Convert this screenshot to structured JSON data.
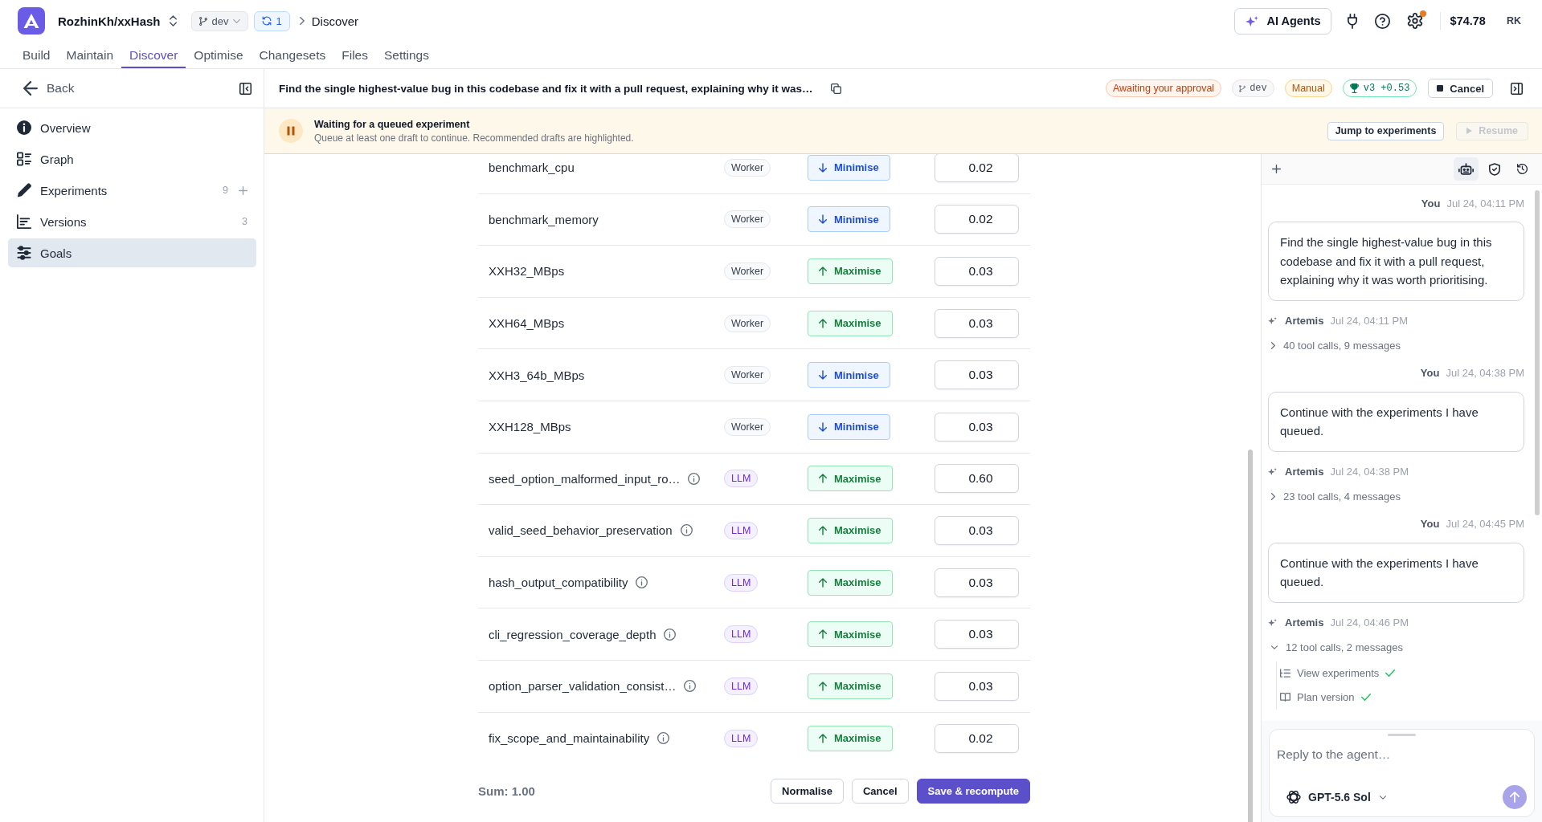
{
  "app_bar": {
    "repository": "RozhinKh/xxHash",
    "branch": "dev",
    "sync_count": "1",
    "breadcrumb": "Discover",
    "ai_agents_button": "AI Agents",
    "settings_notification": true,
    "balance": "$74.78",
    "user_initials": "RK"
  },
  "nav_tabs": [
    {
      "label": "Build",
      "selected": false
    },
    {
      "label": "Maintain",
      "selected": false
    },
    {
      "label": "Discover",
      "selected": true
    },
    {
      "label": "Optimise",
      "selected": false
    },
    {
      "label": "Changesets",
      "selected": false
    },
    {
      "label": "Files",
      "selected": false
    },
    {
      "label": "Settings",
      "selected": false
    }
  ],
  "sidebar": {
    "back_button": "Back",
    "items": [
      {
        "label": "Overview",
        "selected": false,
        "addable": false
      },
      {
        "label": "Graph",
        "selected": false,
        "addable": false
      },
      {
        "label": "Experiments",
        "count": "9",
        "selected": false,
        "addable": true
      },
      {
        "label": "Versions",
        "count": "3",
        "selected": false,
        "addable": false
      },
      {
        "label": "Goals",
        "selected": true,
        "addable": false
      }
    ]
  },
  "task": {
    "title": "Find the single highest-value bug in this codebase and fix it with a pull request, explaining why it was…",
    "status": "Awaiting your approval",
    "branch": "dev",
    "mode": "Manual",
    "score": "v3 +0.53",
    "cancel_button": "Cancel"
  },
  "banner": {
    "title": "Waiting for a queued experiment",
    "message": "Queue at least one draft to continue. Recommended drafts are highlighted.",
    "jump_button": "Jump to experiments",
    "resume_button": {
      "label": "Resume",
      "disabled": true
    }
  },
  "goals": {
    "rows": [
      {
        "name": "benchmark_cpu",
        "info": false,
        "source": {
          "kind": "worker",
          "label": "Worker"
        },
        "direction": {
          "kind": "minimise",
          "label": "Minimise"
        },
        "weight": "0.02"
      },
      {
        "name": "benchmark_memory",
        "info": false,
        "source": {
          "kind": "worker",
          "label": "Worker"
        },
        "direction": {
          "kind": "minimise",
          "label": "Minimise"
        },
        "weight": "0.02"
      },
      {
        "name": "XXH32_MBps",
        "info": false,
        "source": {
          "kind": "worker",
          "label": "Worker"
        },
        "direction": {
          "kind": "maximise",
          "label": "Maximise"
        },
        "weight": "0.03"
      },
      {
        "name": "XXH64_MBps",
        "info": false,
        "source": {
          "kind": "worker",
          "label": "Worker"
        },
        "direction": {
          "kind": "maximise",
          "label": "Maximise"
        },
        "weight": "0.03"
      },
      {
        "name": "XXH3_64b_MBps",
        "info": false,
        "source": {
          "kind": "worker",
          "label": "Worker"
        },
        "direction": {
          "kind": "minimise",
          "label": "Minimise"
        },
        "weight": "0.03"
      },
      {
        "name": "XXH128_MBps",
        "info": false,
        "source": {
          "kind": "worker",
          "label": "Worker"
        },
        "direction": {
          "kind": "minimise",
          "label": "Minimise"
        },
        "weight": "0.03"
      },
      {
        "name": "seed_option_malformed_input_ro…",
        "info": true,
        "source": {
          "kind": "llm",
          "label": "LLM"
        },
        "direction": {
          "kind": "maximise",
          "label": "Maximise"
        },
        "weight": "0.60"
      },
      {
        "name": "valid_seed_behavior_preservation",
        "info": true,
        "source": {
          "kind": "llm",
          "label": "LLM"
        },
        "direction": {
          "kind": "maximise",
          "label": "Maximise"
        },
        "weight": "0.03"
      },
      {
        "name": "hash_output_compatibility",
        "info": true,
        "source": {
          "kind": "llm",
          "label": "LLM"
        },
        "direction": {
          "kind": "maximise",
          "label": "Maximise"
        },
        "weight": "0.03"
      },
      {
        "name": "cli_regression_coverage_depth",
        "info": true,
        "source": {
          "kind": "llm",
          "label": "LLM"
        },
        "direction": {
          "kind": "maximise",
          "label": "Maximise"
        },
        "weight": "0.03"
      },
      {
        "name": "option_parser_validation_consist…",
        "info": true,
        "source": {
          "kind": "llm",
          "label": "LLM"
        },
        "direction": {
          "kind": "maximise",
          "label": "Maximise"
        },
        "weight": "0.03"
      },
      {
        "name": "fix_scope_and_maintainability",
        "info": true,
        "source": {
          "kind": "llm",
          "label": "LLM"
        },
        "direction": {
          "kind": "maximise",
          "label": "Maximise"
        },
        "weight": "0.02"
      }
    ],
    "sum": "Sum: 1.00",
    "normalise_button": "Normalise",
    "cancel_button": "Cancel",
    "save_button": "Save & recompute"
  },
  "chat": {
    "tabs": [
      {
        "selected": true
      },
      {
        "selected": false
      },
      {
        "selected": false
      }
    ],
    "messages": [
      {
        "kind": "user",
        "author": "You",
        "time": "Jul 24, 04:11 PM",
        "text": "Find the single highest-value bug in this codebase and fix it with a pull request, explaining why it was worth prioritising."
      },
      {
        "kind": "agent",
        "author": "Artemis",
        "time": "Jul 24, 04:11 PM",
        "summary": "40 tool calls, 9 messages",
        "expanded": false
      },
      {
        "kind": "user",
        "author": "You",
        "time": "Jul 24, 04:38 PM",
        "text": "Continue with the experiments I have queued."
      },
      {
        "kind": "agent",
        "author": "Artemis",
        "time": "Jul 24, 04:38 PM",
        "summary": "23 tool calls, 4 messages",
        "expanded": false
      },
      {
        "kind": "user",
        "author": "You",
        "time": "Jul 24, 04:45 PM",
        "text": "Continue with the experiments I have queued."
      },
      {
        "kind": "agent",
        "author": "Artemis",
        "time": "Jul 24, 04:46 PM",
        "summary": "12 tool calls, 2 messages",
        "expanded": true,
        "steps": [
          {
            "label": "View experiments",
            "done": true
          },
          {
            "label": "Plan version",
            "done": true
          }
        ]
      }
    ],
    "composer": {
      "placeholder": "Reply to the agent…",
      "model": "GPT-5.6 Sol",
      "send_disabled": true
    }
  }
}
